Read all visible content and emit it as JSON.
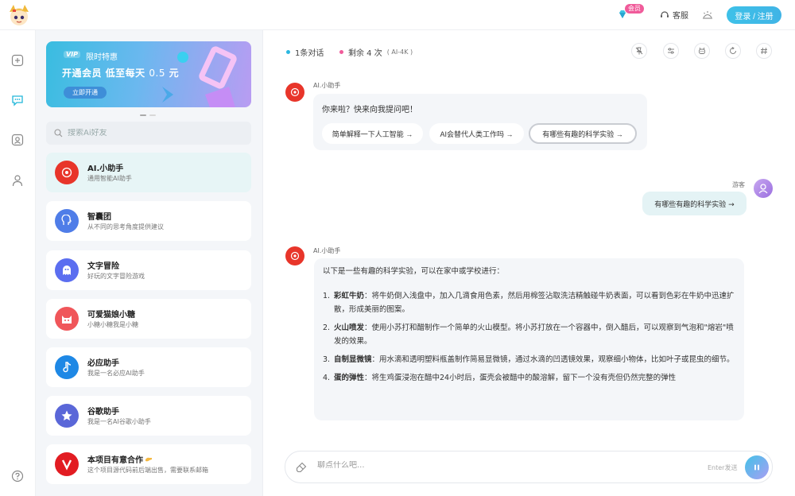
{
  "header": {
    "vip_tag": "会员",
    "service_label": "客服",
    "login_label": "登录 / 注册"
  },
  "banner": {
    "vip": "VIP",
    "subtitle": "限时特惠",
    "title": "开通会员 低至每天",
    "price": "0.5",
    "unit": "元",
    "button": "立即开通"
  },
  "search": {
    "placeholder": "搜索Ai好友"
  },
  "bots": [
    {
      "name": "AI.小助手",
      "desc": "通用智能AI助手",
      "color": "#e8352a"
    },
    {
      "name": "智囊团",
      "desc": "从不同的思考角度提供建议",
      "color": "#4f7de8"
    },
    {
      "name": "文字冒险",
      "desc": "好玩的文字冒险游戏",
      "color": "#5b6ef0"
    },
    {
      "name": "可爱猫娘小糖",
      "desc": "小糖小糖我是小糖",
      "color": "#f0565a"
    },
    {
      "name": "必应助手",
      "desc": "我是一名必应AI助手",
      "color": "#1e88e5"
    },
    {
      "name": "谷歌助手",
      "desc": "我是一名AI谷歌小助手",
      "color": "#5a67d8"
    },
    {
      "name": "本项目有意合作",
      "desc": "这个项目源代码前后端出售，需要联系邮箱",
      "color": "#e21c22"
    }
  ],
  "stats": {
    "conversations": "1条对话",
    "remaining": "剩余 4 次",
    "model": "( AI-4K )"
  },
  "chat": {
    "bot_name": "AI.小助手",
    "greeting": "你来啦？快来向我提问吧！",
    "suggestions": [
      "简单解释一下人工智能 →",
      "AI会替代人类工作吗 →",
      "有哪些有趣的科学实验 →"
    ],
    "user_name": "游客",
    "user_message": "有哪些有趣的科学实验 →",
    "answer_intro": "以下是一些有趣的科学实验，可以在家中或学校进行：",
    "answer_items": [
      {
        "num": "1.",
        "title": "彩虹牛奶",
        "text": "：将牛奶倒入浅盘中，加入几滴食用色素，然后用棉签沾取洗洁精触碰牛奶表面，可以看到色彩在牛奶中迅速扩散，形成美丽的图案。"
      },
      {
        "num": "2.",
        "title": "火山喷发",
        "text": "：使用小苏打和醋制作一个简单的火山模型。将小苏打放在一个容器中，倒入醋后，可以观察到气泡和\"熔岩\"喷发的效果。"
      },
      {
        "num": "3.",
        "title": "自制显微镜",
        "text": "：用水滴和透明塑料瓶盖制作简易显微镜，通过水滴的凹透镜效果，观察细小物体，比如叶子或昆虫的细节。"
      },
      {
        "num": "4.",
        "title": "蛋的弹性",
        "text": "：将生鸡蛋浸泡在醋中24小时后，蛋壳会被醋中的酸溶解，留下一个没有壳但仍然完整的弹性"
      }
    ]
  },
  "composer": {
    "placeholder": "聊点什么吧...",
    "hint": "Enter发送"
  }
}
